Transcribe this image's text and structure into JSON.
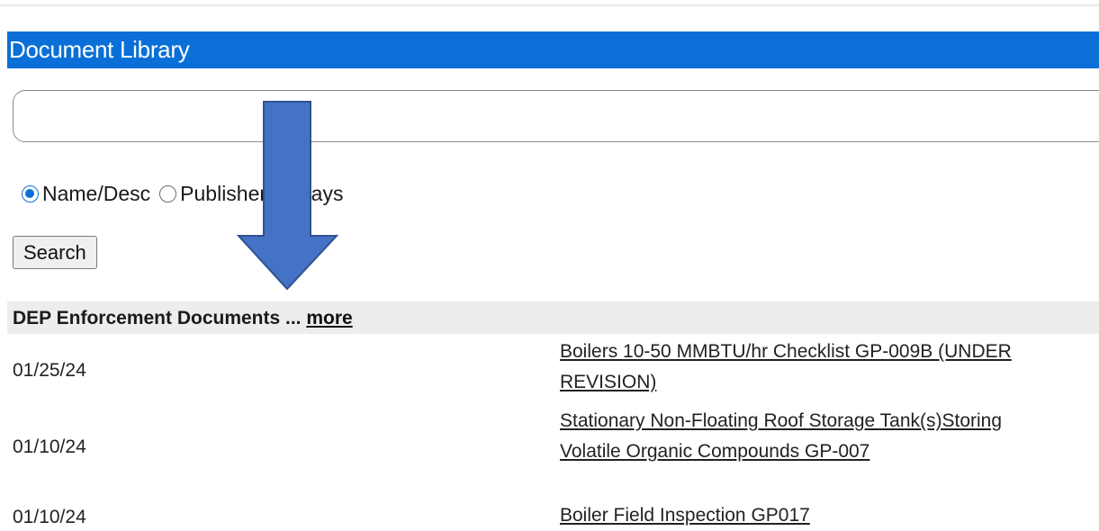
{
  "header": {
    "title": "Document Library"
  },
  "search": {
    "value": "",
    "placeholder": ""
  },
  "filters": {
    "options": [
      {
        "label": "Name/Desc",
        "checked": true
      },
      {
        "label": "Publisher",
        "checked": false
      },
      {
        "label": "Days",
        "checked": false
      }
    ]
  },
  "search_button": {
    "label": "Search"
  },
  "section": {
    "title": "DEP Enforcement Documents ...",
    "more_label": "more"
  },
  "documents": [
    {
      "date": "01/25/24",
      "title": "Boilers 10-50 MMBTU/hr Checklist GP-009B (UNDER REVISION)"
    },
    {
      "date": "01/10/24",
      "title": "Stationary Non-Floating Roof Storage Tank(s)Storing Volatile Organic Compounds GP-007"
    },
    {
      "date": "01/10/24",
      "title": "Boiler Field Inspection GP017"
    }
  ],
  "annotation": {
    "arrow_color": "#4472c4",
    "arrow_outline": "#2f528f",
    "icon": "arrow-down-icon"
  }
}
